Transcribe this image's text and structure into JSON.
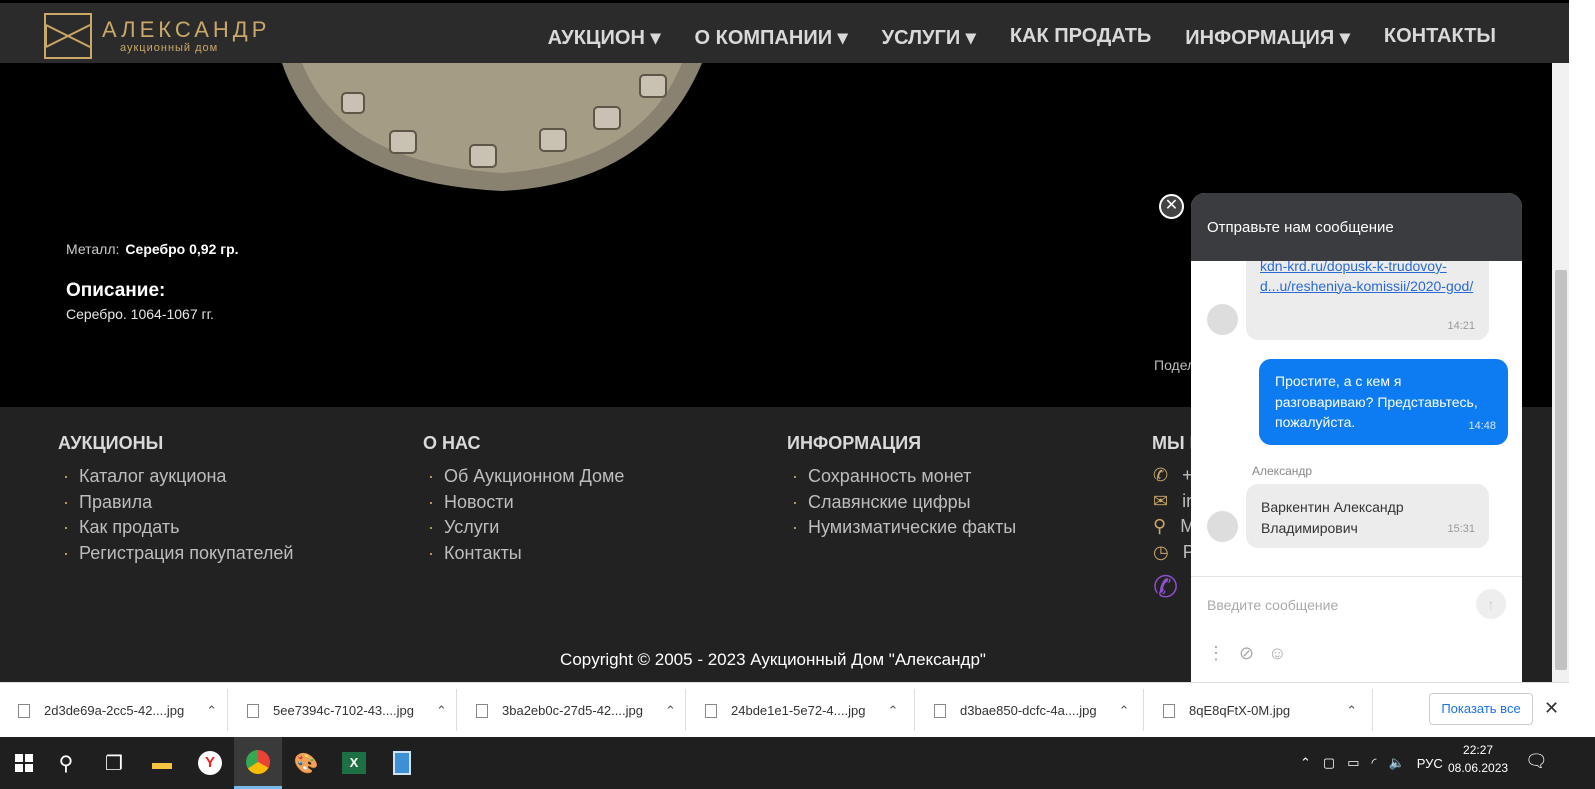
{
  "header": {
    "logo_title": "АЛЕКСАНДР",
    "logo_subtitle": "аукционный дом",
    "nav": [
      "АУКЦИОН ▾",
      "О КОМПАНИИ ▾",
      "УСЛУГИ ▾",
      "КАК ПРОДАТЬ",
      "ИНФОРМАЦИЯ ▾",
      "КОНТАКТЫ"
    ]
  },
  "item": {
    "metal_label": "Металл:",
    "metal_value": "Серебро 0,92 гр.",
    "description_heading": "Описание:",
    "description_text": "Серебро. 1064-1067 гг.",
    "share_label": "Подел"
  },
  "footer": {
    "auctions": {
      "title": "АУКЦИОНЫ",
      "links": [
        "Каталог аукциона",
        "Правила",
        "Как продать",
        "Регистрация покупателей"
      ]
    },
    "about": {
      "title": "О НАС",
      "links": [
        "Об Аукционном Доме",
        "Новости",
        "Услуги",
        "Контакты"
      ]
    },
    "info": {
      "title": "ИНФОРМАЦИЯ",
      "links": [
        "Сохранность монет",
        "Славянские цифры",
        "Нумизматические факты"
      ]
    },
    "contacts": {
      "title": "МЫ В",
      "rows": [
        "+",
        "in",
        "М",
        "Р"
      ]
    },
    "copyright": "Copyright © 2005 - 2023 Аукционный Дом \"Александр\""
  },
  "chat": {
    "header": "Отправьте нам сообщение",
    "messages": {
      "link_text": "kdn-krd.ru/dopusk-k-trudovoy-d...u/resheniya-komissii/2020-god/",
      "link_time": "14:21",
      "out_text": "Простите, а с кем я разговариваю? Представьтесь, пожалуйста.",
      "out_time": "14:48",
      "agent_name": "Александр",
      "in_text": "Варкентин Александр Владимирович",
      "in_time": "15:31"
    },
    "input_placeholder": "Введите сообщение"
  },
  "downloads": {
    "items": [
      "2d3de69a-2cc5-42....jpg",
      "5ee7394c-7102-43....jpg",
      "3ba2eb0c-27d5-42....jpg",
      "24bde1e1-5e72-4....jpg",
      "d3bae850-dcfc-4a....jpg",
      "8qE8qFtX-0M.jpg"
    ],
    "show_all": "Показать все"
  },
  "taskbar": {
    "lang": "РУС",
    "time": "22:27",
    "date": "08.06.2023"
  }
}
